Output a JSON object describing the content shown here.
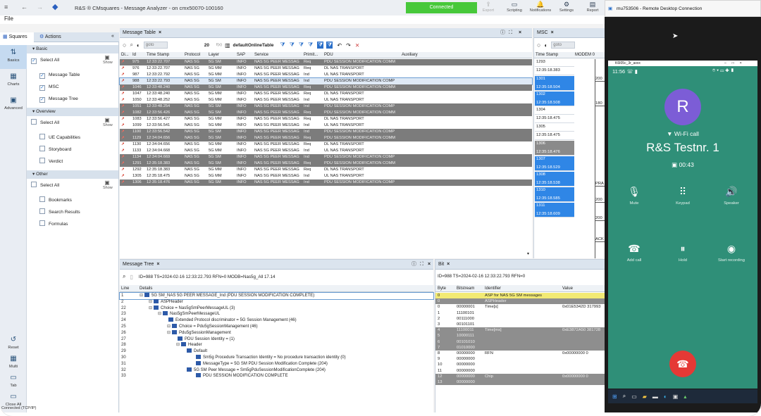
{
  "titlebar": {
    "title": "R&S ® CMsquares - Message Analyzer - on cmx50070-100160",
    "status": "Connected",
    "tools": [
      {
        "label": "Export",
        "icon": "export-icon",
        "glyph": "⇪",
        "disabled": true
      },
      {
        "label": "Scripting",
        "icon": "scripting-icon",
        "glyph": "▭",
        "disabled": false
      },
      {
        "label": "Notifications",
        "icon": "bell-icon",
        "glyph": "🔔",
        "disabled": false
      },
      {
        "label": "Settings",
        "icon": "gear-icon",
        "glyph": "⚙",
        "disabled": false
      },
      {
        "label": "Report",
        "icon": "report-icon",
        "glyph": "▤",
        "disabled": false
      }
    ]
  },
  "menu": {
    "file": "File"
  },
  "left_panel": {
    "tabs": {
      "squares": "Squares",
      "actions": "Actions"
    },
    "side_buttons": [
      {
        "label": "Basics",
        "glyph": "⇅"
      },
      {
        "label": "Charts",
        "glyph": "▦"
      },
      {
        "label": "Advanced",
        "glyph": "▣"
      }
    ],
    "bottom_buttons": [
      {
        "label": "Reset",
        "glyph": "↺"
      },
      {
        "label": "Multi",
        "glyph": "▦"
      },
      {
        "label": "Tab",
        "glyph": "▭"
      },
      {
        "label": "Close All",
        "glyph": "▭"
      }
    ],
    "status": "Connected (TCP/IP)",
    "groups": [
      {
        "label": "Basic",
        "select_all": "Select All",
        "show": "Show",
        "items": [
          {
            "label": "Message Table",
            "checked": true
          },
          {
            "label": "MSC",
            "checked": true
          },
          {
            "label": "Message Tree",
            "checked": true
          }
        ]
      },
      {
        "label": "Overview",
        "select_all": "Select All",
        "show": "Show",
        "items": [
          {
            "label": "UE Capabilities",
            "checked": false
          },
          {
            "label": "Storyboard",
            "checked": false
          },
          {
            "label": "Verdict",
            "checked": false
          }
        ]
      },
      {
        "label": "Other",
        "select_all": "Select All",
        "show": "Show",
        "items": [
          {
            "label": "Bookmarks",
            "checked": false
          },
          {
            "label": "Search Results",
            "checked": false
          },
          {
            "label": "Formulas",
            "checked": false
          }
        ]
      }
    ]
  },
  "message_table": {
    "title": "Message Table",
    "goto_placeholder": "goto",
    "count": "20",
    "view_name": "defaultOnlineTable",
    "fx": "f(x)",
    "columns": [
      "Di...",
      "Id",
      "Time Stamp",
      "Protocol",
      "Layer",
      "SAP",
      "Service",
      "Primit...",
      "PDU",
      "Auxiliary"
    ],
    "rows": [
      {
        "dir": "↗",
        "id": "975",
        "ts": "12:33:22.707",
        "proto": "NAS 5G",
        "layer": "5G SM",
        "sap": "INFO",
        "svc": "NAS 5G PEER MESSAG",
        "prim": "Req",
        "pdu": "PDU SESSION MODIFICATION COMM",
        "dark": true
      },
      {
        "dir": "↗",
        "id": "976",
        "ts": "12:33:22.707",
        "proto": "NAS 5G",
        "layer": "5G MM",
        "sap": "INFO",
        "svc": "NAS 5G PEER MESSAG",
        "prim": "Req",
        "pdu": "DL NAS TRANSPORT",
        "dark": false
      },
      {
        "dir": "↗",
        "id": "987",
        "ts": "12:33:22.792",
        "proto": "NAS 5G",
        "layer": "5G MM",
        "sap": "INFO",
        "svc": "NAS 5G PEER MESSAG",
        "prim": "Ind",
        "pdu": "UL NAS TRANSPORT",
        "dark": false
      },
      {
        "dir": "↗",
        "id": "988",
        "ts": "12:33:22.793",
        "proto": "NAS 5G",
        "layer": "5G SM",
        "sap": "INFO",
        "svc": "NAS 5G PEER MESSAG",
        "prim": "Ind",
        "pdu": "PDU SESSION MODIFICATION COMP",
        "sel": true
      },
      {
        "dir": "↗",
        "id": "1046",
        "ts": "12:33:48.240",
        "proto": "NAS 5G",
        "layer": "5G SM",
        "sap": "INFO",
        "svc": "NAS 5G PEER MESSAG",
        "prim": "Req",
        "pdu": "PDU SESSION MODIFICATION COMM",
        "dark": true
      },
      {
        "dir": "↗",
        "id": "1047",
        "ts": "12:33:48.240",
        "proto": "NAS 5G",
        "layer": "5G MM",
        "sap": "INFO",
        "svc": "NAS 5G PEER MESSAG",
        "prim": "Req",
        "pdu": "DL NAS TRANSPORT",
        "dark": false
      },
      {
        "dir": "↗",
        "id": "1050",
        "ts": "12:33:48.252",
        "proto": "NAS 5G",
        "layer": "5G MM",
        "sap": "INFO",
        "svc": "NAS 5G PEER MESSAG",
        "prim": "Ind",
        "pdu": "UL NAS TRANSPORT",
        "dark": false
      },
      {
        "dir": "↗",
        "id": "1051",
        "ts": "12:33:48.254",
        "proto": "NAS 5G",
        "layer": "5G SM",
        "sap": "INFO",
        "svc": "NAS 5G PEER MESSAG",
        "prim": "Ind",
        "pdu": "PDU SESSION MODIFICATION COMP",
        "dark": true
      },
      {
        "dir": "↗",
        "id": "1082",
        "ts": "12:33:56.426",
        "proto": "NAS 5G",
        "layer": "5G SM",
        "sap": "INFO",
        "svc": "NAS 5G PEER MESSAG",
        "prim": "Req",
        "pdu": "PDU SESSION MODIFICATION COMM",
        "dark": true
      },
      {
        "dir": "↗",
        "id": "1083",
        "ts": "12:33:56.427",
        "proto": "NAS 5G",
        "layer": "5G MM",
        "sap": "INFO",
        "svc": "NAS 5G PEER MESSAG",
        "prim": "Req",
        "pdu": "DL NAS TRANSPORT",
        "dark": false
      },
      {
        "dir": "↗",
        "id": "1099",
        "ts": "12:33:56.541",
        "proto": "NAS 5G",
        "layer": "5G MM",
        "sap": "INFO",
        "svc": "NAS 5G PEER MESSAG",
        "prim": "Ind",
        "pdu": "UL NAS TRANSPORT",
        "dark": false
      },
      {
        "dir": "↗",
        "id": "1100",
        "ts": "12:33:56.542",
        "proto": "NAS 5G",
        "layer": "5G SM",
        "sap": "INFO",
        "svc": "NAS 5G PEER MESSAG",
        "prim": "Ind",
        "pdu": "PDU SESSION MODIFICATION COMP",
        "dark": true
      },
      {
        "dir": "↗",
        "id": "1129",
        "ts": "12:34:04.656",
        "proto": "NAS 5G",
        "layer": "5G SM",
        "sap": "INFO",
        "svc": "NAS 5G PEER MESSAG",
        "prim": "Req",
        "pdu": "PDU SESSION MODIFICATION COMM",
        "dark": true
      },
      {
        "dir": "↗",
        "id": "1130",
        "ts": "12:34:04.656",
        "proto": "NAS 5G",
        "layer": "5G MM",
        "sap": "INFO",
        "svc": "NAS 5G PEER MESSAG",
        "prim": "Req",
        "pdu": "DL NAS TRANSPORT",
        "dark": false
      },
      {
        "dir": "↗",
        "id": "1133",
        "ts": "12:34:04.668",
        "proto": "NAS 5G",
        "layer": "5G MM",
        "sap": "INFO",
        "svc": "NAS 5G PEER MESSAG",
        "prim": "Ind",
        "pdu": "UL NAS TRANSPORT",
        "dark": false
      },
      {
        "dir": "↗",
        "id": "1134",
        "ts": "12:34:04.669",
        "proto": "NAS 5G",
        "layer": "5G SM",
        "sap": "INFO",
        "svc": "NAS 5G PEER MESSAG",
        "prim": "Ind",
        "pdu": "PDU SESSION MODIFICATION COMP",
        "dark": true
      },
      {
        "dir": "↗",
        "id": "1291",
        "ts": "12:35:18.383",
        "proto": "NAS 5G",
        "layer": "5G SM",
        "sap": "INFO",
        "svc": "NAS 5G PEER MESSAG",
        "prim": "Req",
        "pdu": "PDU SESSION MODIFICATION COMM",
        "dark": true
      },
      {
        "dir": "↗",
        "id": "1292",
        "ts": "12:35:18.383",
        "proto": "NAS 5G",
        "layer": "5G MM",
        "sap": "INFO",
        "svc": "NAS 5G PEER MESSAG",
        "prim": "Req",
        "pdu": "DL NAS TRANSPORT",
        "dark": false
      },
      {
        "dir": "↗",
        "id": "1305",
        "ts": "12:35:18.475",
        "proto": "NAS 5G",
        "layer": "5G MM",
        "sap": "INFO",
        "svc": "NAS 5G PEER MESSAG",
        "prim": "Ind",
        "pdu": "UL NAS TRANSPORT",
        "dark": false
      },
      {
        "dir": "↗",
        "id": "1306",
        "ts": "12:35:18.476",
        "proto": "NAS 5G",
        "layer": "5G SM",
        "sap": "INFO",
        "svc": "NAS 5G PEER MESSAG",
        "prim": "Ind",
        "pdu": "PDU SESSION MODIFICATION COMP",
        "dark": true
      }
    ]
  },
  "msc": {
    "title": "MSC",
    "goto_placeholder": "goto",
    "columns": [
      "Time Stamp",
      "MODEM 0"
    ],
    "cells": [
      {
        "id": "1293",
        "ts": "",
        "style": "w"
      },
      {
        "id": "",
        "ts": "12:35:18.383",
        "style": "w"
      },
      {
        "id": "1301",
        "ts": "12:35:18.504",
        "style": "b"
      },
      {
        "id": "1302",
        "ts": "12:35:18.508",
        "style": "b"
      },
      {
        "id": "1304",
        "ts": "",
        "style": "w"
      },
      {
        "id": "",
        "ts": "12:35:18.475",
        "style": "w"
      },
      {
        "id": "1305",
        "ts": "",
        "style": "w"
      },
      {
        "id": "",
        "ts": "12:35:18.475",
        "style": "w"
      },
      {
        "id": "1306",
        "ts": "12:35:18.476",
        "style": "g"
      },
      {
        "id": "1307",
        "ts": "12:35:18.529",
        "style": "b"
      },
      {
        "id": "1308",
        "ts": "12:35:18.538",
        "style": "b"
      },
      {
        "id": "1310",
        "ts": "12:35:18.585",
        "style": "b"
      },
      {
        "id": "1311",
        "ts": "12:35:18.609",
        "style": "b"
      }
    ],
    "right_labels": [
      "200",
      "180",
      "PRA",
      "200",
      "200",
      "ACK"
    ]
  },
  "message_tree": {
    "title": "Message Tree",
    "header": "ID=988 TS=2024-02-16 12:33:22.793 RFN=0 MODB=Nas5g_All 17.14",
    "columns": [
      "Line",
      "Details"
    ],
    "rows": [
      {
        "ln": "1",
        "indent": 0,
        "tx": "5G SM_NAS 5G PEER MESSAGE_Ind (PDU SESSION MODIFICATION COMPLETE)",
        "sel": true
      },
      {
        "ln": "2",
        "indent": 1,
        "tx": "ASPHeader"
      },
      {
        "ln": "22",
        "indent": 1,
        "tx": "Choice = Nas5gSmPeerMessageUL (3)"
      },
      {
        "ln": "23",
        "indent": 2,
        "tx": "Nas5gSmPeerMessageUL"
      },
      {
        "ln": "24",
        "indent": 3,
        "tx": "Extended Protocol discriminator = 5G Session Management (46)"
      },
      {
        "ln": "25",
        "indent": 3,
        "tx": "Choice = Pdu5gSessionManagement (46)"
      },
      {
        "ln": "26",
        "indent": 3,
        "tx": "Pdu5gSessionManagement"
      },
      {
        "ln": "27",
        "indent": 4,
        "tx": "PDU Session Identity = (1)"
      },
      {
        "ln": "28",
        "indent": 4,
        "tx": "Header"
      },
      {
        "ln": "29",
        "indent": 5,
        "tx": "Default"
      },
      {
        "ln": "30",
        "indent": 6,
        "tx": "Sm5g Procedure Transaction Identity = No procedure transaction identity (0)"
      },
      {
        "ln": "31",
        "indent": 6,
        "tx": "MessageType = 5G SM PDU Session Modification Complete (204)"
      },
      {
        "ln": "32",
        "indent": 5,
        "tx": "5G SM Peer Message = Sm5gPduSessionModificationComplete (204)"
      },
      {
        "ln": "33",
        "indent": 6,
        "tx": "PDU SESSION MODIFICATION COMPLETE"
      }
    ]
  },
  "bit_view": {
    "title": "Bit",
    "header": "ID=988 TS=2024-02-16 12:33:22.793 RFN=0",
    "columns": [
      "Byte",
      "Bitstream",
      "Identifier",
      "Value"
    ],
    "rows": [
      {
        "b": "0",
        "bs": "",
        "id": "ASP for NAS 5G SM messages",
        "v": "",
        "style": "y"
      },
      {
        "b": "0",
        "bs": "",
        "id": "ASPHeader",
        "v": "",
        "style": "g"
      },
      {
        "b": "0",
        "bs": "00000001",
        "id": "Time[s]",
        "v": "0x01E5342D 317993",
        "style": ""
      },
      {
        "b": "1",
        "bs": "11100101",
        "id": "",
        "v": "",
        "style": ""
      },
      {
        "b": "2",
        "bs": "00111000",
        "id": "",
        "v": "",
        "style": ""
      },
      {
        "b": "3",
        "bs": "00101101",
        "id": "",
        "v": "",
        "style": ""
      },
      {
        "b": "4",
        "bs": "11100011",
        "id": "Time[ms]",
        "v": "0xE3872A50 381728",
        "style": "g"
      },
      {
        "b": "5",
        "bs": "10000111",
        "id": "",
        "v": "",
        "style": "g"
      },
      {
        "b": "6",
        "bs": "00101010",
        "id": "",
        "v": "",
        "style": "g"
      },
      {
        "b": "7",
        "bs": "01010000",
        "id": "",
        "v": "",
        "style": "g"
      },
      {
        "b": "8",
        "bs": "00000000",
        "id": "RFN",
        "v": "0x00000000 0",
        "style": ""
      },
      {
        "b": "9",
        "bs": "00000000",
        "id": "",
        "v": "",
        "style": ""
      },
      {
        "b": "10",
        "bs": "00000000",
        "id": "",
        "v": "",
        "style": ""
      },
      {
        "b": "11",
        "bs": "00000000",
        "id": "",
        "v": "",
        "style": ""
      },
      {
        "b": "12",
        "bs": "00000000",
        "id": "Chip",
        "v": "0x00000000 0",
        "style": "g"
      },
      {
        "b": "13",
        "bs": "00000000",
        "id": "",
        "v": "",
        "style": "g"
      }
    ]
  },
  "phone": {
    "rdp_title": "mu753506 - Remote Desktop Connection",
    "window_title": "K6I05c_3r_axxx",
    "time": "11:56",
    "avatar_letter": "R",
    "call_type": "Wi-Fi call",
    "contact": "R&S Testnr. 1",
    "duration": "00:43",
    "controls": [
      {
        "label": "Mute",
        "glyph": "🎙"
      },
      {
        "label": "Keypad",
        "glyph": "⠿"
      },
      {
        "label": "Speaker",
        "glyph": "🔊"
      },
      {
        "label": "Add call",
        "glyph": "☎"
      },
      {
        "label": "Hold",
        "glyph": "⏸"
      },
      {
        "label": "Start recording",
        "glyph": "◉"
      }
    ]
  },
  "colors": {
    "accent": "#2f86e6",
    "connected": "#47c83a",
    "call_bg": "#2f8f78",
    "end_call": "#e53935"
  }
}
